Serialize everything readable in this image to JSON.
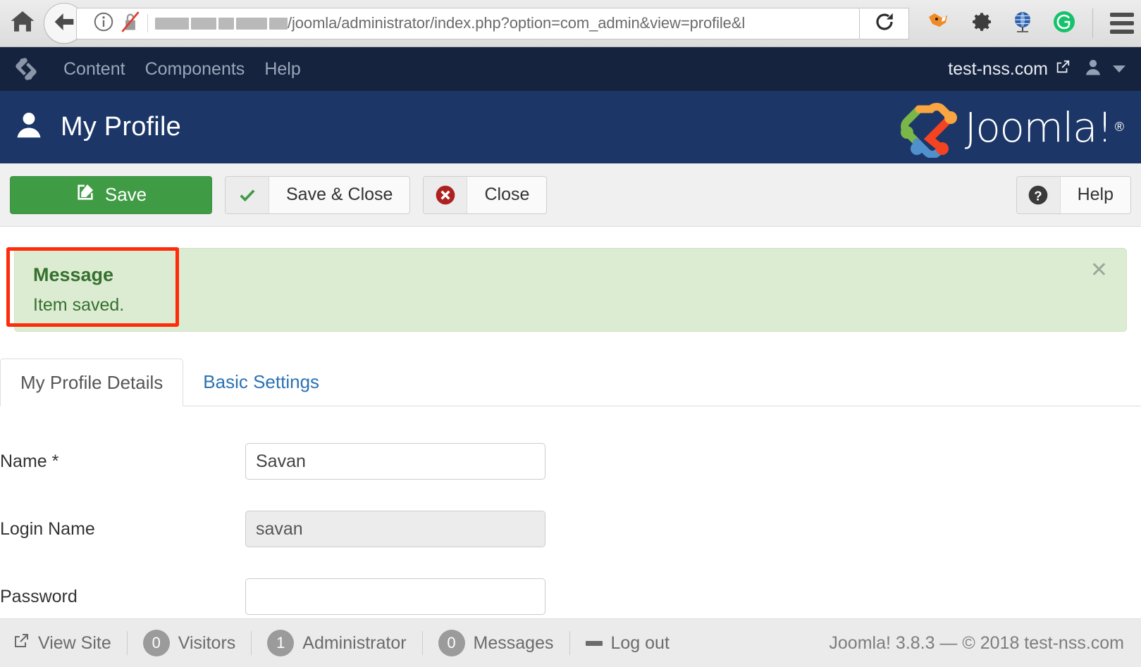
{
  "browser": {
    "home_icon": "home-icon",
    "back_icon": "back-arrow-icon",
    "info_icon": "info-circle-icon",
    "security_icon": "broken-lock-icon",
    "url_text": "/joomla/administrator/index.php?option=com_admin&view=profile&l",
    "reload_icon": "reload-icon",
    "extensions": [
      "foxyproxy-icon",
      "gear-icon",
      "globe-icon",
      "grammarly-icon"
    ],
    "menu_icon": "hamburger-menu-icon"
  },
  "admin_nav": {
    "logo_icon": "joomla-logo-mark",
    "items": [
      {
        "label": "Content"
      },
      {
        "label": "Components"
      },
      {
        "label": "Help"
      }
    ],
    "site_name": "test-nss.com",
    "site_link_icon": "external-link-icon",
    "user_icon": "user-icon",
    "caret_icon": "chevron-down-icon"
  },
  "header": {
    "icon": "user-icon",
    "title": "My Profile",
    "brand_text": "Joomla!",
    "brand_registered": "®"
  },
  "toolbar": {
    "save": {
      "label": "Save",
      "icon": "edit-pencil-square-icon"
    },
    "save_close": {
      "label": "Save & Close",
      "icon": "check-icon"
    },
    "close": {
      "label": "Close",
      "icon": "close-circle-icon"
    },
    "help": {
      "label": "Help",
      "icon": "question-circle-icon"
    }
  },
  "alert": {
    "heading": "Message",
    "text": "Item saved.",
    "close_icon": "close-icon",
    "type": "success",
    "bg_color": "#dcecd2",
    "text_color": "#35702e",
    "annotation_color": "#fd2c0a"
  },
  "tabs": [
    {
      "label": "My Profile Details",
      "active": true
    },
    {
      "label": "Basic Settings",
      "active": false
    }
  ],
  "form": {
    "fields": [
      {
        "label": "Name *",
        "value": "Savan",
        "readonly": false,
        "placeholder": ""
      },
      {
        "label": "Login Name",
        "value": "savan",
        "readonly": true,
        "placeholder": ""
      },
      {
        "label": "Password",
        "value": "",
        "readonly": false,
        "placeholder": ""
      }
    ]
  },
  "footer": {
    "view_site": {
      "label": "View Site",
      "icon": "external-link-icon"
    },
    "visitors": {
      "count": "0",
      "label": "Visitors"
    },
    "administrator": {
      "count": "1",
      "label": "Administrator"
    },
    "messages": {
      "count": "0",
      "label": "Messages"
    },
    "logout": {
      "label": "Log out",
      "icon": "logout-icon"
    },
    "copyright": "Joomla! 3.8.3  —  © 2018 test-nss.com"
  }
}
